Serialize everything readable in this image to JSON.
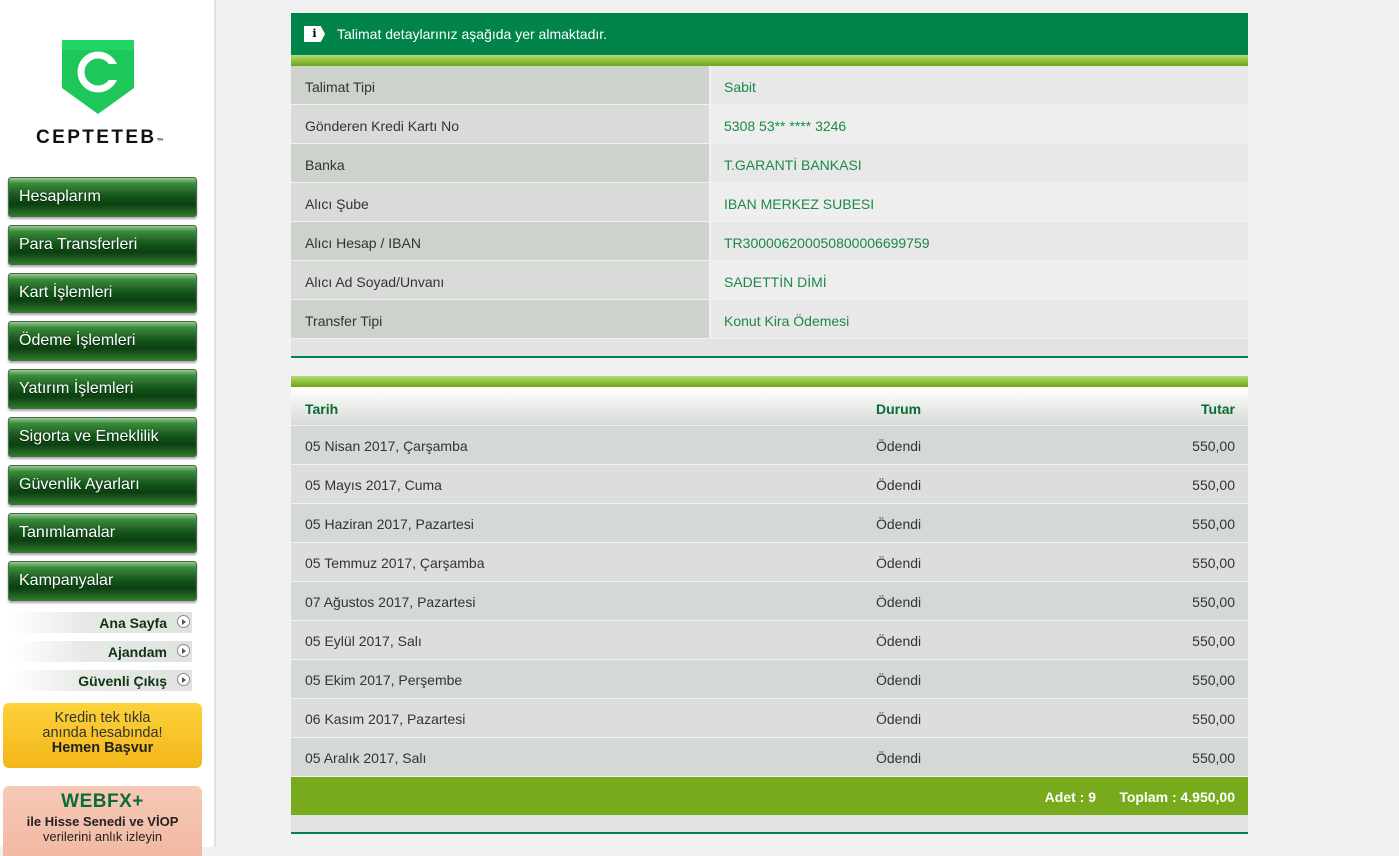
{
  "brand": {
    "name": "CEPTETEB",
    "trademark": "™",
    "logo_letter": "C",
    "color_primary": "#00844a",
    "color_accent": "#78aa1e"
  },
  "sidebar": {
    "menu": [
      {
        "label": "Hesaplarım"
      },
      {
        "label": "Para Transferleri"
      },
      {
        "label": "Kart İşlemleri"
      },
      {
        "label": "Ödeme İşlemleri"
      },
      {
        "label": "Yatırım İşlemleri"
      },
      {
        "label": "Sigorta ve Emeklilik"
      },
      {
        "label": "Güvenlik Ayarları"
      },
      {
        "label": "Tanımlamalar"
      },
      {
        "label": "Kampanyalar"
      }
    ],
    "quick_links": [
      {
        "label": "Ana Sayfa"
      },
      {
        "label": "Ajandam"
      },
      {
        "label": "Güvenli Çıkış"
      }
    ],
    "promo_credit": {
      "line1": "Kredin tek tıkla",
      "line2": "anında hesabında!",
      "cta": "Hemen Başvur"
    },
    "promo_webfx": {
      "title": "WEBFX+",
      "line1": "ile Hisse Senedi ve VİOP",
      "line2": "verilerini anlık izleyin"
    }
  },
  "info": {
    "icon_letter": "i",
    "message": "Talimat detaylarınız aşağıda yer almaktadır."
  },
  "details": [
    {
      "label": "Talimat Tipi",
      "value": "Sabit"
    },
    {
      "label": "Gönderen Kredi Kartı No",
      "value": "5308 53** **** 3246"
    },
    {
      "label": "Banka",
      "value": "T.GARANTİ BANKASI"
    },
    {
      "label": "Alıcı Şube",
      "value": "IBAN MERKEZ SUBESI"
    },
    {
      "label": "Alıcı Hesap / IBAN",
      "value": "TR300006200050800006699759"
    },
    {
      "label": "Alıcı Ad Soyad/Unvanı",
      "value": "SADETTİN DİMİ"
    },
    {
      "label": "Transfer Tipi",
      "value": "Konut Kira Ödemesi"
    }
  ],
  "payments": {
    "headers": {
      "date": "Tarih",
      "status": "Durum",
      "amount": "Tutar"
    },
    "rows": [
      {
        "date": "05 Nisan 2017, Çarşamba",
        "status": "Ödendi",
        "amount": "550,00"
      },
      {
        "date": "05 Mayıs 2017, Cuma",
        "status": "Ödendi",
        "amount": "550,00"
      },
      {
        "date": "05 Haziran 2017, Pazartesi",
        "status": "Ödendi",
        "amount": "550,00"
      },
      {
        "date": "05 Temmuz 2017, Çarşamba",
        "status": "Ödendi",
        "amount": "550,00"
      },
      {
        "date": "07 Ağustos 2017, Pazartesi",
        "status": "Ödendi",
        "amount": "550,00"
      },
      {
        "date": "05 Eylül 2017, Salı",
        "status": "Ödendi",
        "amount": "550,00"
      },
      {
        "date": "05 Ekim 2017, Perşembe",
        "status": "Ödendi",
        "amount": "550,00"
      },
      {
        "date": "06 Kasım 2017, Pazartesi",
        "status": "Ödendi",
        "amount": "550,00"
      },
      {
        "date": "05 Aralık 2017, Salı",
        "status": "Ödendi",
        "amount": "550,00"
      }
    ],
    "summary": {
      "count": "Adet : 9",
      "total": "Toplam : 4.950,00"
    }
  }
}
